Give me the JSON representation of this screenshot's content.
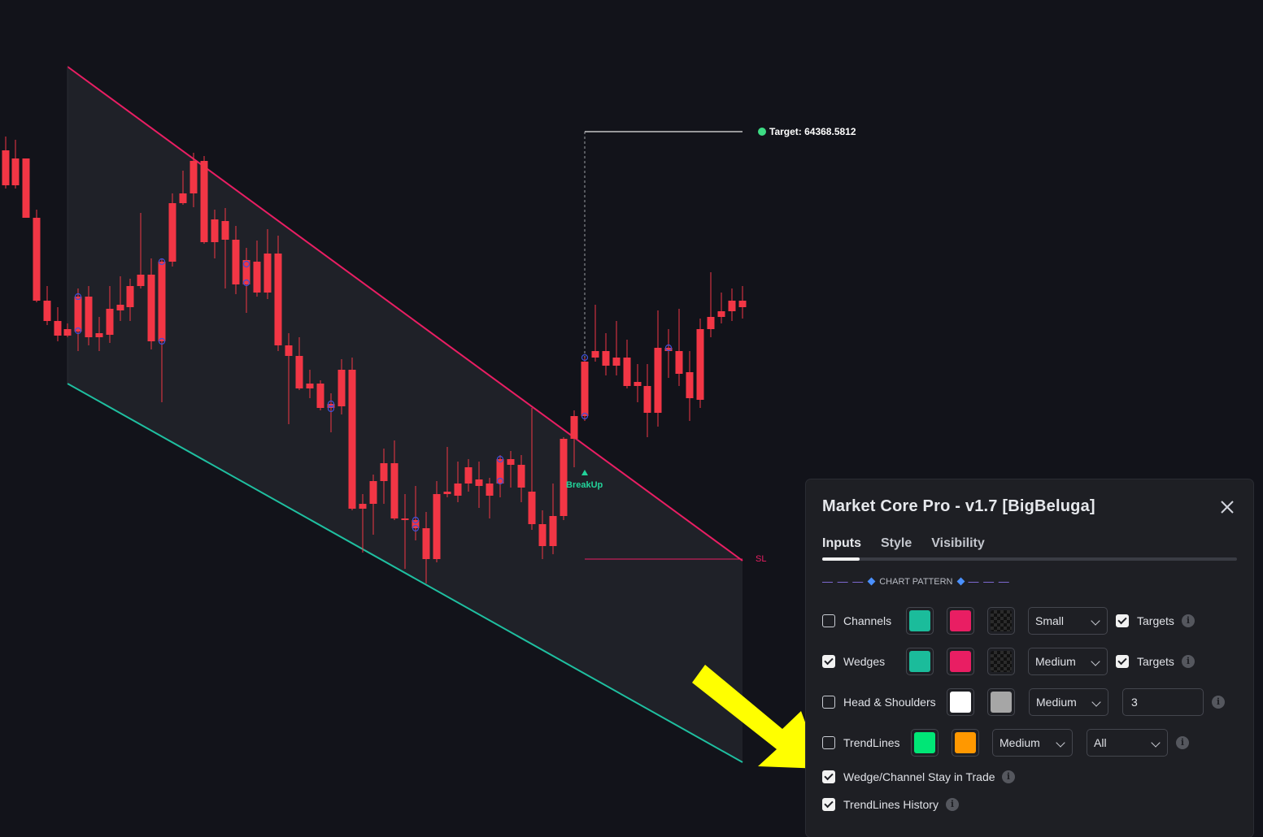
{
  "chart": {
    "target_label": "Target: 64368.5812",
    "sl_label": "SL",
    "breakup_label": "BreakUp",
    "breakup_icon": "triangle-up-icon",
    "colors": {
      "bull": "#1aa88b",
      "bear": "#f23645",
      "upper_line": "#e91e63",
      "lower_line": "#1fbfa0",
      "channel_fill": "#1f2128",
      "marker": "#3f51d6",
      "target_dot": "#3ddc84",
      "breakup": "#22d39a",
      "arrow": "#ffff00"
    }
  },
  "panel": {
    "title": "Market Core Pro - v1.7 [BigBeluga]",
    "close_icon": "close-icon",
    "tabs": [
      {
        "label": "Inputs",
        "active": true
      },
      {
        "label": "Style",
        "active": false
      },
      {
        "label": "Visibility",
        "active": false
      }
    ],
    "section_header": "CHART PATTERN",
    "rows": {
      "channels": {
        "label": "Channels",
        "checked": false,
        "color1": "#1bbc9b",
        "color2": "#e91e63",
        "color3": "transparent",
        "size": "Small",
        "targets_label": "Targets",
        "targets_checked": true
      },
      "wedges": {
        "label": "Wedges",
        "checked": true,
        "color1": "#1bbc9b",
        "color2": "#e91e63",
        "color3": "transparent",
        "size": "Medium",
        "targets_label": "Targets",
        "targets_checked": true
      },
      "head_shoulders": {
        "label": "Head & Shoulders",
        "checked": false,
        "color1": "#ffffff",
        "color2": "#a6a6a6",
        "size": "Medium",
        "value": "3"
      },
      "trendlines": {
        "label": "TrendLines",
        "checked": false,
        "color1": "#00e676",
        "color2": "#ff9800",
        "size": "Medium",
        "filter": "All"
      },
      "stay_in_trade": {
        "label": "Wedge/Channel Stay in Trade",
        "checked": true
      },
      "trendlines_history": {
        "label": "TrendLines History",
        "checked": true
      }
    },
    "info_icon": "info-icon",
    "info_glyph": "i"
  }
}
